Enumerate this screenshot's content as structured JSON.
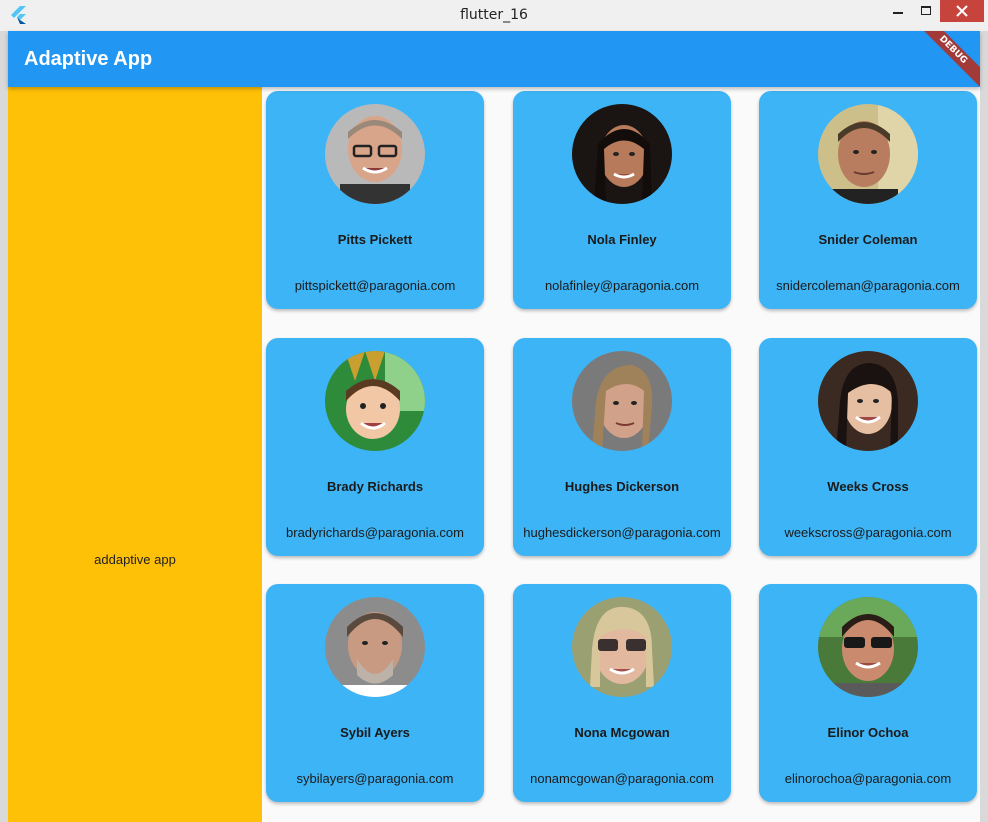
{
  "window": {
    "title": "flutter_16"
  },
  "appbar": {
    "title": "Adaptive App",
    "debug_label": "DEBUG"
  },
  "side": {
    "text": "addaptive app"
  },
  "colors": {
    "appbar": "#2196f3",
    "side": "#ffc107",
    "card": "#3db4f5"
  },
  "people": [
    {
      "name": "Pitts Pickett",
      "email": "pittspickett@paragonia.com"
    },
    {
      "name": "Nola Finley",
      "email": "nolafinley@paragonia.com"
    },
    {
      "name": "Snider Coleman",
      "email": "snidercoleman@paragonia.com"
    },
    {
      "name": "Brady Richards",
      "email": "bradyrichards@paragonia.com"
    },
    {
      "name": "Hughes Dickerson",
      "email": "hughesdickerson@paragonia.com"
    },
    {
      "name": "Weeks Cross",
      "email": "weekscross@paragonia.com"
    },
    {
      "name": "Sybil Ayers",
      "email": "sybilayers@paragonia.com"
    },
    {
      "name": "Nona Mcgowan",
      "email": "nonamcgowan@paragonia.com"
    },
    {
      "name": "Elinor Ochoa",
      "email": "elinorochoa@paragonia.com"
    }
  ]
}
